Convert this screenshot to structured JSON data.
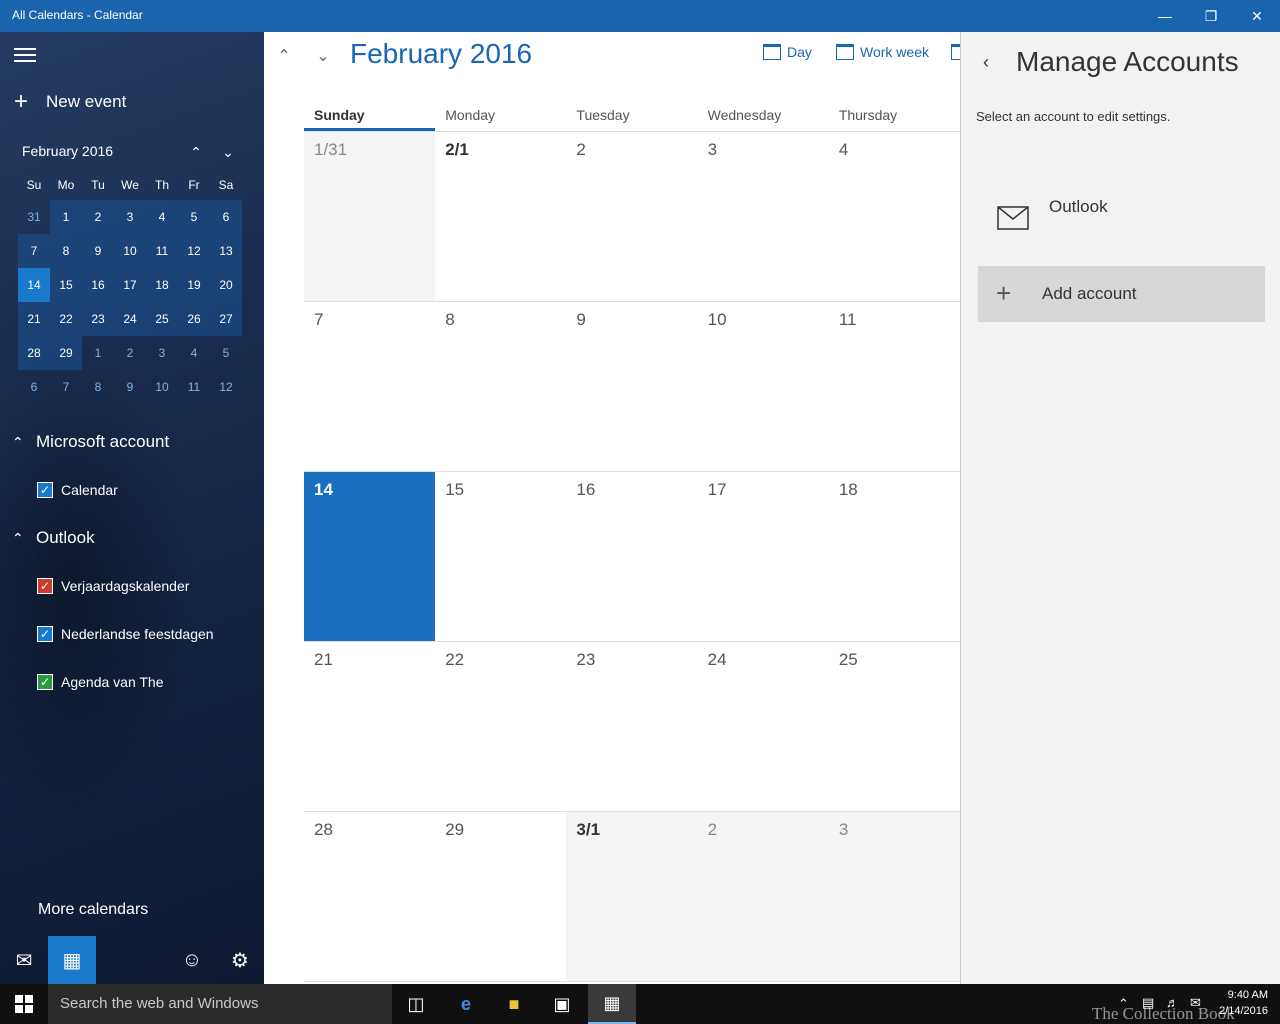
{
  "window": {
    "title": "All Calendars - Calendar"
  },
  "sidebar": {
    "new_event": "New event",
    "mini_month": "February 2016",
    "mini_dow": [
      "Su",
      "Mo",
      "Tu",
      "We",
      "Th",
      "Fr",
      "Sa"
    ],
    "mini_weeks": [
      [
        "31",
        "1",
        "2",
        "3",
        "4",
        "5",
        "6"
      ],
      [
        "7",
        "8",
        "9",
        "10",
        "11",
        "12",
        "13"
      ],
      [
        "14",
        "15",
        "16",
        "17",
        "18",
        "19",
        "20"
      ],
      [
        "21",
        "22",
        "23",
        "24",
        "25",
        "26",
        "27"
      ],
      [
        "28",
        "29",
        "1",
        "2",
        "3",
        "4",
        "5"
      ],
      [
        "6",
        "7",
        "8",
        "9",
        "10",
        "11",
        "12"
      ]
    ],
    "sections": [
      {
        "name": "Microsoft account",
        "items": [
          {
            "label": "Calendar",
            "color": "#1979ca"
          }
        ]
      },
      {
        "name": "Outlook",
        "items": [
          {
            "label": "Verjaardagskalender",
            "color": "#c93b2b"
          },
          {
            "label": "Nederlandse feestdagen",
            "color": "#1979ca"
          },
          {
            "label": "Agenda van The",
            "color": "#2c9b3e"
          }
        ]
      }
    ],
    "more_calendars": "More calendars"
  },
  "main": {
    "month_title": "February 2016",
    "views": {
      "day": "Day",
      "workweek": "Work week"
    },
    "dow": [
      "Sunday",
      "Monday",
      "Tuesday",
      "Wednesday",
      "Thursday"
    ],
    "weeks": [
      [
        "1/31",
        "2/1",
        "2",
        "3",
        "4"
      ],
      [
        "7",
        "8",
        "9",
        "10",
        "11"
      ],
      [
        "14",
        "15",
        "16",
        "17",
        "18"
      ],
      [
        "21",
        "22",
        "23",
        "24",
        "25"
      ],
      [
        "28",
        "29",
        "3/1",
        "2",
        "3"
      ]
    ]
  },
  "pane": {
    "title": "Manage Accounts",
    "subtitle": "Select an account to edit settings.",
    "account": "Outlook",
    "add_account": "Add account"
  },
  "taskbar": {
    "search_placeholder": "Search the web and Windows",
    "time": "9:40 AM",
    "date": "2/14/2016",
    "watermark": "The Collection Book"
  }
}
